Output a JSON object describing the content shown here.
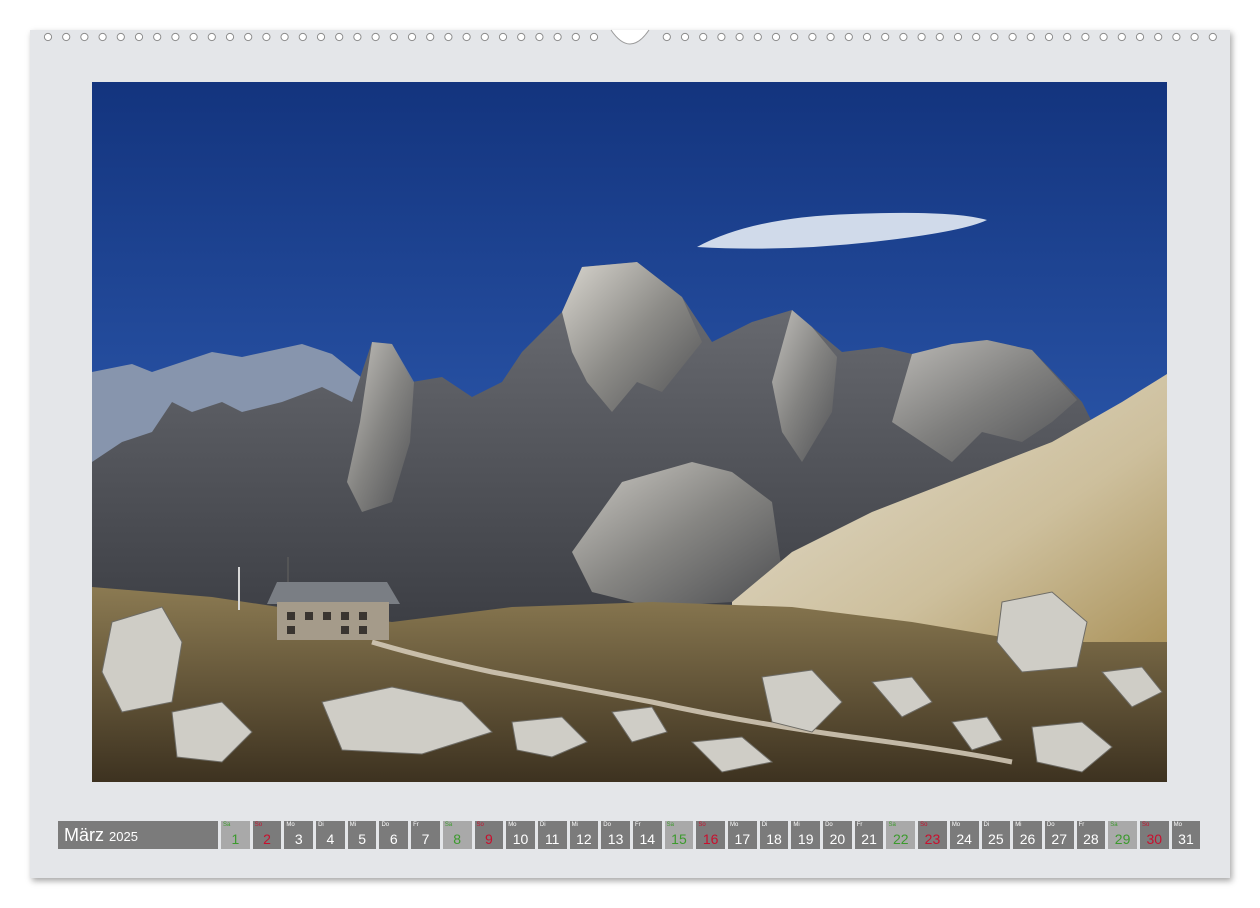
{
  "calendar": {
    "month": "März",
    "year": "2025",
    "days": [
      {
        "num": "1",
        "wd": "Sa",
        "kind": "saturday"
      },
      {
        "num": "2",
        "wd": "So",
        "kind": "sunday"
      },
      {
        "num": "3",
        "wd": "Mo",
        "kind": "weekday"
      },
      {
        "num": "4",
        "wd": "Di",
        "kind": "weekday"
      },
      {
        "num": "5",
        "wd": "Mi",
        "kind": "weekday"
      },
      {
        "num": "6",
        "wd": "Do",
        "kind": "weekday"
      },
      {
        "num": "7",
        "wd": "Fr",
        "kind": "weekday"
      },
      {
        "num": "8",
        "wd": "Sa",
        "kind": "saturday"
      },
      {
        "num": "9",
        "wd": "So",
        "kind": "sunday"
      },
      {
        "num": "10",
        "wd": "Mo",
        "kind": "weekday"
      },
      {
        "num": "11",
        "wd": "Di",
        "kind": "weekday"
      },
      {
        "num": "12",
        "wd": "Mi",
        "kind": "weekday"
      },
      {
        "num": "13",
        "wd": "Do",
        "kind": "weekday"
      },
      {
        "num": "14",
        "wd": "Fr",
        "kind": "weekday"
      },
      {
        "num": "15",
        "wd": "Sa",
        "kind": "saturday"
      },
      {
        "num": "16",
        "wd": "So",
        "kind": "sunday"
      },
      {
        "num": "17",
        "wd": "Mo",
        "kind": "weekday"
      },
      {
        "num": "18",
        "wd": "Di",
        "kind": "weekday"
      },
      {
        "num": "19",
        "wd": "Mi",
        "kind": "weekday"
      },
      {
        "num": "20",
        "wd": "Do",
        "kind": "weekday"
      },
      {
        "num": "21",
        "wd": "Fr",
        "kind": "weekday"
      },
      {
        "num": "22",
        "wd": "Sa",
        "kind": "saturday"
      },
      {
        "num": "23",
        "wd": "So",
        "kind": "sunday"
      },
      {
        "num": "24",
        "wd": "Mo",
        "kind": "weekday"
      },
      {
        "num": "25",
        "wd": "Di",
        "kind": "weekday"
      },
      {
        "num": "26",
        "wd": "Mi",
        "kind": "weekday"
      },
      {
        "num": "27",
        "wd": "Do",
        "kind": "weekday"
      },
      {
        "num": "28",
        "wd": "Fr",
        "kind": "weekday"
      },
      {
        "num": "29",
        "wd": "Sa",
        "kind": "saturday"
      },
      {
        "num": "30",
        "wd": "So",
        "kind": "sunday"
      },
      {
        "num": "31",
        "wd": "Mo",
        "kind": "weekday"
      }
    ]
  },
  "colors": {
    "sheet": "#e4e6e9",
    "cell": "#7b7b7b",
    "weekend_cell": "#a9a9a9",
    "sunday_text": "#c8102e",
    "saturday_text": "#3c9a2d",
    "sky": "#1b3f8f"
  },
  "photo": {
    "subject": "mountain-landscape-with-hut"
  }
}
